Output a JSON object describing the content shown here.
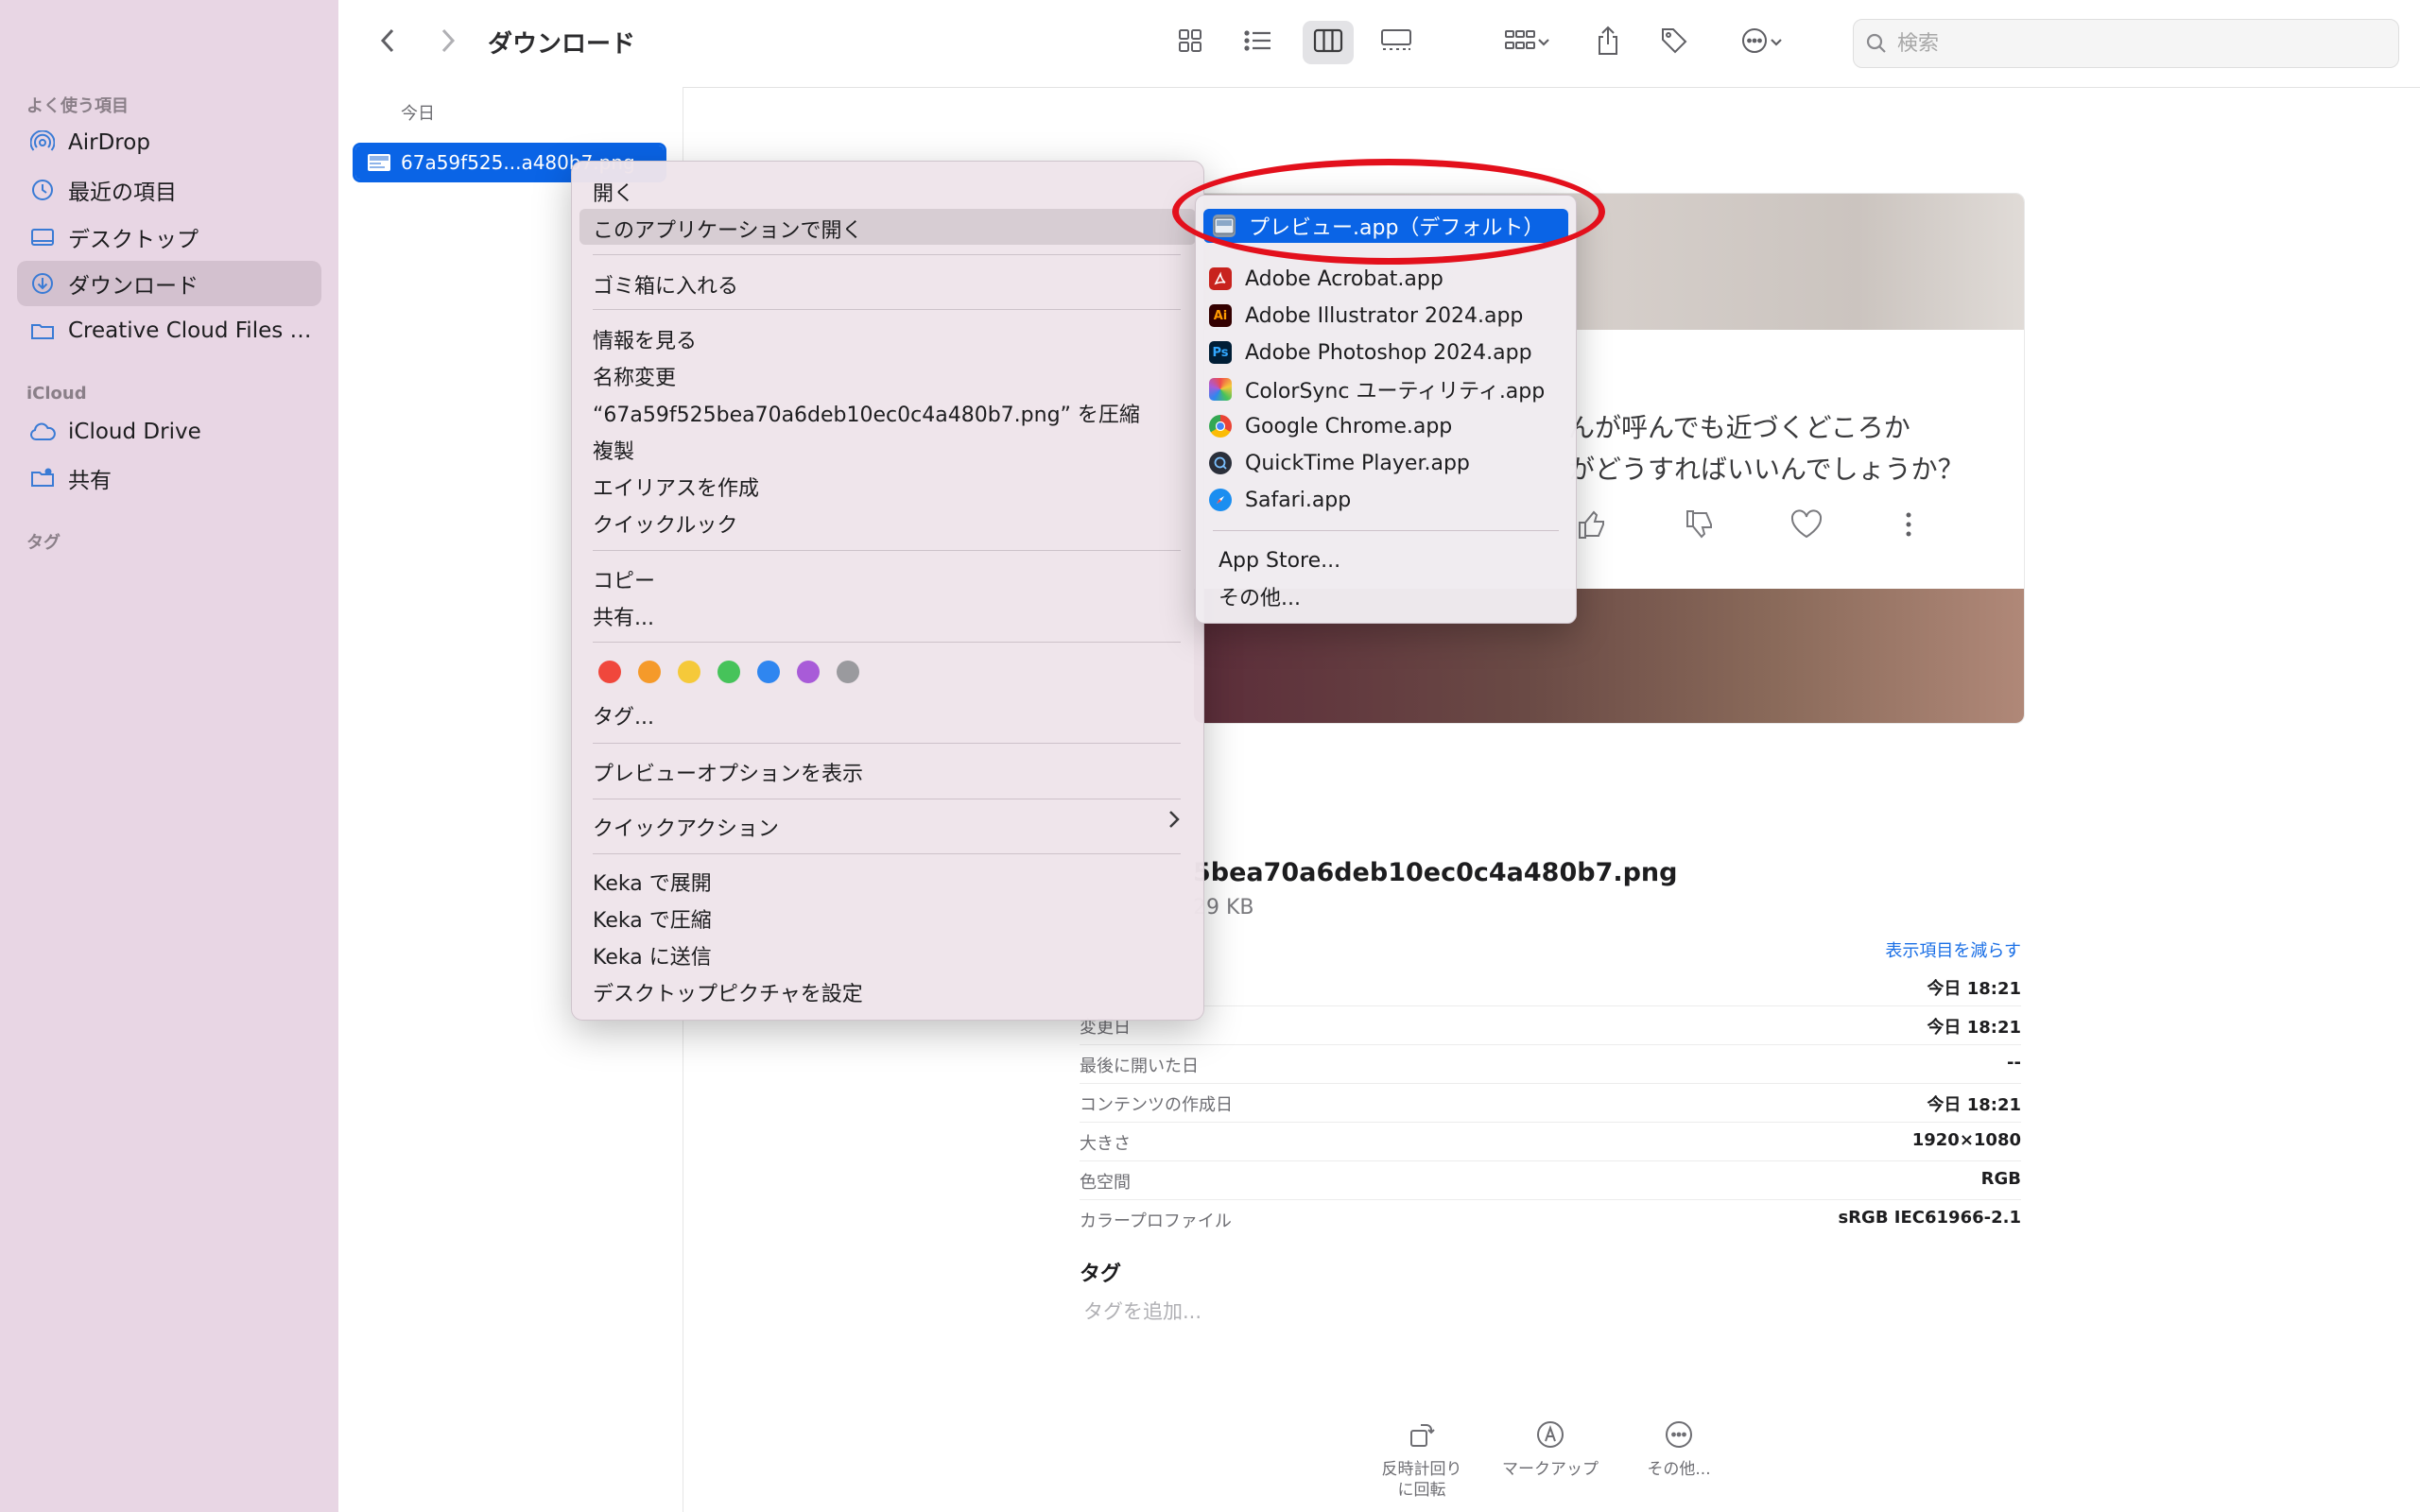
{
  "sidebar": {
    "sections": {
      "favorites": "よく使う項目",
      "icloud": "iCloud",
      "tags": "タグ"
    },
    "favorites": [
      {
        "label": "AirDrop",
        "icon": "airdrop-icon"
      },
      {
        "label": "最近の項目",
        "icon": "clock-icon"
      },
      {
        "label": "デスクトップ",
        "icon": "desktop-icon"
      },
      {
        "label": "ダウンロード",
        "icon": "download-icon",
        "selected": true
      },
      {
        "label": "Creative Cloud Files P...",
        "icon": "folder-icon"
      }
    ],
    "icloud_items": [
      {
        "label": "iCloud Drive",
        "icon": "cloud-icon"
      },
      {
        "label": "共有",
        "icon": "shared-folder-icon"
      }
    ]
  },
  "toolbar": {
    "title": "ダウンロード",
    "search_placeholder": "検索"
  },
  "column": {
    "header": "今日",
    "file": "67a59f525...a480b7.png"
  },
  "preview": {
    "text_line1": "んが呼んでも近づくどころか",
    "text_line2": "がどうすればいいんでしょうか？",
    "filename": "5bea70a6deb10ec0c4a480b7.png",
    "filesize": "29 KB",
    "show_less": "表示項目を減らす",
    "metadata": [
      {
        "key": "",
        "value": "今日 18:21"
      },
      {
        "key": "変更日",
        "value": "今日 18:21"
      },
      {
        "key": "最後に開いた日",
        "value": "--"
      },
      {
        "key": "コンテンツの作成日",
        "value": "今日 18:21"
      },
      {
        "key": "大きさ",
        "value": "1920×1080"
      },
      {
        "key": "色空間",
        "value": "RGB"
      },
      {
        "key": "カラープロファイル",
        "value": "sRGB IEC61966-2.1"
      }
    ],
    "tags_title": "タグ",
    "tags_placeholder": "タグを追加...",
    "actions": [
      {
        "label_line1": "反時計回り",
        "label_line2": "に回転"
      },
      {
        "label_line1": "マークアップ",
        "label_line2": ""
      },
      {
        "label_line1": "その他...",
        "label_line2": ""
      }
    ]
  },
  "context_menu": {
    "open": "開く",
    "open_with": "このアプリケーションで開く",
    "trash": "ゴミ箱に入れる",
    "get_info": "情報を見る",
    "rename": "名称変更",
    "compress": "“67a59f525bea70a6deb10ec0c4a480b7.png” を圧縮",
    "duplicate": "複製",
    "make_alias": "エイリアスを作成",
    "quick_look": "クイックルック",
    "copy": "コピー",
    "share": "共有...",
    "tags": "タグ...",
    "show_preview_options": "プレビューオプションを表示",
    "quick_actions": "クイックアクション",
    "keka_extract": "Keka で展開",
    "keka_compress": "Keka で圧縮",
    "keka_send": "Keka に送信",
    "set_desktop": "デスクトップピクチャを設定",
    "tag_colors": [
      "#f0473c",
      "#f59a2a",
      "#f5c93a",
      "#46c35a",
      "#2f86f0",
      "#a85bd8",
      "#9a9a9e"
    ]
  },
  "open_with_menu": {
    "apps": [
      {
        "label": "プレビュー.app（デフォルト）",
        "icon": "preview-app-icon",
        "badge": "",
        "color": "#8a98a8",
        "selected": true
      },
      {
        "label": "Adobe Acrobat.app",
        "icon": "acrobat-app-icon",
        "badge": "A",
        "color": "#c8231e"
      },
      {
        "label": "Adobe Illustrator 2024.app",
        "icon": "illustrator-app-icon",
        "badge": "Ai",
        "color": "#330000"
      },
      {
        "label": "Adobe Photoshop 2024.app",
        "icon": "photoshop-app-icon",
        "badge": "Ps",
        "color": "#001e36"
      },
      {
        "label": "ColorSync ユーティリティ.app",
        "icon": "colorsync-app-icon",
        "badge": "",
        "color": "#e0a030"
      },
      {
        "label": "Google Chrome.app",
        "icon": "chrome-app-icon",
        "badge": "",
        "color": "#2b9e4a"
      },
      {
        "label": "QuickTime Player.app",
        "icon": "quicktime-app-icon",
        "badge": "",
        "color": "#2a2f3a"
      },
      {
        "label": "Safari.app",
        "icon": "safari-app-icon",
        "badge": "",
        "color": "#1b8ef0"
      }
    ],
    "app_store": "App Store...",
    "other": "その他..."
  }
}
